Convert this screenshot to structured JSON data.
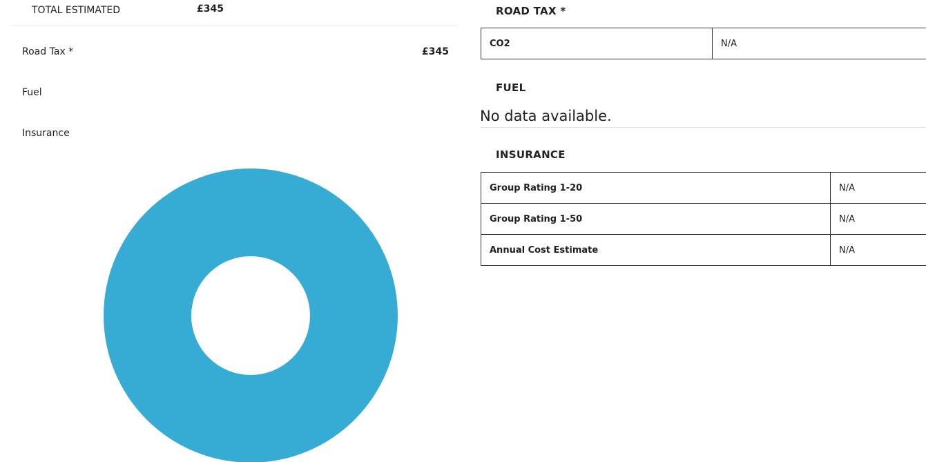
{
  "summary": {
    "total_label": "TOTAL ESTIMATED",
    "total_value": "£345",
    "rows": [
      {
        "label": "Road Tax *",
        "value": "£345"
      },
      {
        "label": "Fuel",
        "value": ""
      },
      {
        "label": "Insurance",
        "value": ""
      }
    ]
  },
  "chart_data": {
    "type": "pie",
    "variant": "donut",
    "title": "",
    "categories": [
      "Road Tax *"
    ],
    "values": [
      345
    ],
    "colors": [
      "#36acd5"
    ]
  },
  "road_tax": {
    "heading": "ROAD TAX *",
    "rows": [
      {
        "key": "CO2",
        "value": "N/A"
      }
    ]
  },
  "fuel": {
    "heading": "FUEL",
    "empty_message": "No data available."
  },
  "insurance": {
    "heading": "INSURANCE",
    "rows": [
      {
        "key": "Group Rating 1-20",
        "value": "N/A"
      },
      {
        "key": "Group Rating 1-50",
        "value": "N/A"
      },
      {
        "key": "Annual Cost Estimate",
        "value": "N/A"
      }
    ]
  }
}
